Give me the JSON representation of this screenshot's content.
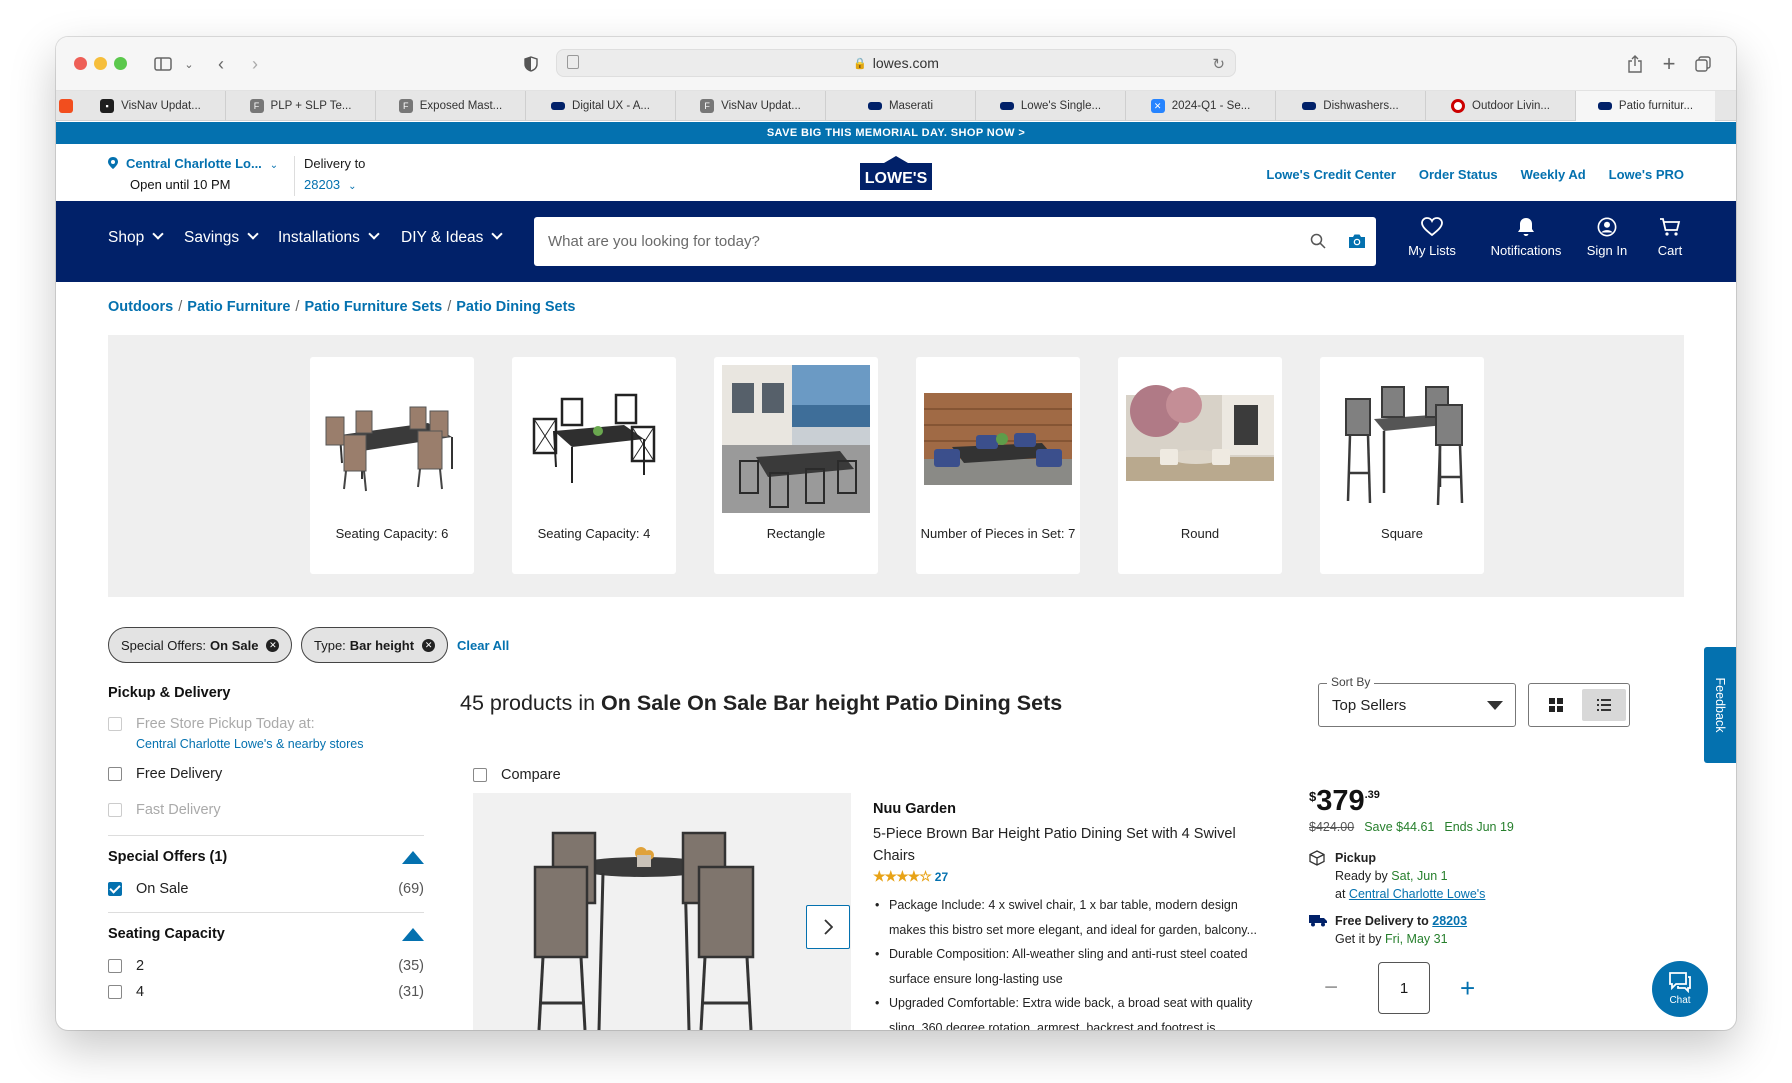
{
  "browser": {
    "url": "lowes.com",
    "tabs": [
      {
        "label": "VisNav Updat...",
        "icon": "figma-icon"
      },
      {
        "label": "PLP + SLP Te...",
        "icon": "f-icon"
      },
      {
        "label": "Exposed Mast...",
        "icon": "f-icon"
      },
      {
        "label": "Digital UX - A...",
        "icon": "lowes-icon"
      },
      {
        "label": "VisNav Updat...",
        "icon": "f-icon"
      },
      {
        "label": "Maserati",
        "icon": "lowes-icon"
      },
      {
        "label": "Lowe's Single...",
        "icon": "lowes-icon"
      },
      {
        "label": "2024-Q1 - Se...",
        "icon": "confluence-icon"
      },
      {
        "label": "Dishwashers...",
        "icon": "lowes-icon"
      },
      {
        "label": "Outdoor Livin...",
        "icon": "target-icon"
      },
      {
        "label": "Patio furnitur...",
        "icon": "lowes-icon"
      }
    ]
  },
  "promo": "SAVE BIG THIS MEMORIAL DAY. SHOP NOW >",
  "header": {
    "store_name": "Central Charlotte Lo...",
    "store_hours": "Open until 10 PM",
    "delivery_label": "Delivery to",
    "zip": "28203",
    "logo_text": "LOWE'S",
    "links": [
      "Lowe's Credit Center",
      "Order Status",
      "Weekly Ad",
      "Lowe's PRO"
    ]
  },
  "nav": {
    "shop": "Shop",
    "savings": "Savings",
    "installations": "Installations",
    "diy": "DIY & Ideas",
    "search_placeholder": "What are you looking for today?",
    "my_lists": "My Lists",
    "notifications": "Notifications",
    "sign_in": "Sign In",
    "cart": "Cart"
  },
  "breadcrumbs": [
    "Outdoors",
    "Patio Furniture",
    "Patio Furniture Sets",
    "Patio Dining Sets"
  ],
  "categories": [
    {
      "label": "Seating Capacity: 6"
    },
    {
      "label": "Seating Capacity: 4"
    },
    {
      "label": "Rectangle"
    },
    {
      "label": "Number of Pieces in Set: 7"
    },
    {
      "label": "Round"
    },
    {
      "label": "Square"
    }
  ],
  "filters": {
    "chip1_label": "Special Offers:",
    "chip1_value": "On Sale",
    "chip2_label": "Type:",
    "chip2_value": "Bar height",
    "clear_all": "Clear All"
  },
  "sidebar": {
    "pickup_heading": "Pickup & Delivery",
    "free_store_pickup": "Free Store Pickup Today at:",
    "store_link": "Central Charlotte Lowe's & nearby stores",
    "free_delivery": "Free Delivery",
    "fast_delivery": "Fast Delivery",
    "special_heading": "Special Offers (1)",
    "on_sale": "On Sale",
    "on_sale_count": "(69)",
    "seating_heading": "Seating Capacity",
    "seat_2": "2",
    "seat_2_count": "(35)",
    "seat_4": "4",
    "seat_4_count": "(31)"
  },
  "results": {
    "count_text": "45 products in",
    "query": "On Sale On Sale Bar height Patio Dining Sets",
    "sort_label": "Sort By",
    "sort_value": "Top Sellers",
    "compare": "Compare",
    "feedback": "Feedback"
  },
  "product": {
    "brand": "Nuu Garden",
    "title": "5-Piece Brown Bar Height Patio Dining Set with 4 Swivel Chairs",
    "rating": 4.5,
    "reviews": "27",
    "bullet1": "Package Include: 4 x swivel chair, 1 x bar table, modern design",
    "bullet1b": "makes this bistro set more elegant, and ideal for garden, balcony...",
    "bullet2": "Durable Composition: All-weather sling and anti-rust steel coated",
    "bullet2b": "surface ensure long-lasting use",
    "bullet3": "Upgraded Comfortable: Extra wide back, a broad seat with quality",
    "bullet3b": "sling, 360 degree rotation, armrest, backrest and footrest is",
    "price_currency": "$",
    "price_dollars": "379",
    "price_cents": ".39",
    "was_price": "$424.00",
    "save_text": "Save $44.61",
    "ends_text": "Ends Jun 19",
    "pickup_title": "Pickup",
    "pickup_ready": "Ready by",
    "pickup_date": "Sat, Jun 1",
    "pickup_at": "at",
    "pickup_store": "Central Charlotte Lowe's",
    "delivery_title": "Free Delivery to",
    "delivery_zip": "28203",
    "delivery_get": "Get it by",
    "delivery_date": "Fri, May 31",
    "quantity": "1"
  },
  "chat": "Chat",
  "colors": {
    "lowes_blue": "#0471af",
    "nav_navy": "#012169",
    "save_green": "#267f2c"
  }
}
